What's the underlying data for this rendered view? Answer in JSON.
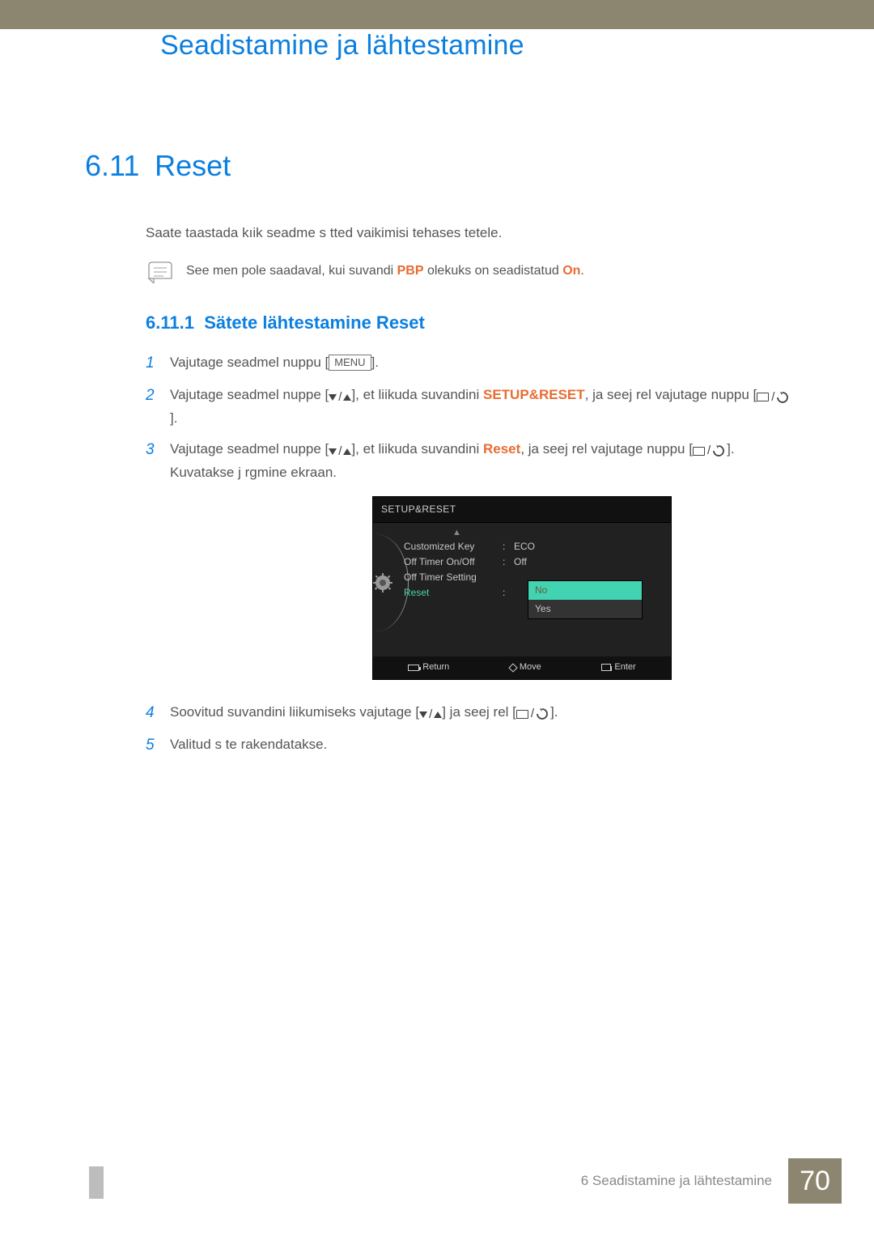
{
  "header": {
    "chapter_title": "Seadistamine ja lähtestamine"
  },
  "section": {
    "number": "6.11",
    "title": "Reset",
    "intro": "Saate taastada kıik seadme s  tted vaikimisi tehases  tetele.",
    "note_prefix": "See men     pole saadaval, kui suvandi ",
    "note_hl1": "PBP",
    "note_mid": " olekuks on seadistatud ",
    "note_hl2": "On",
    "note_suffix": "."
  },
  "subsection": {
    "number": "6.11.1",
    "title": "Sätete lähtestamine Reset"
  },
  "steps": {
    "s1_a": "Vajutage seadmel nuppu [",
    "s1_menu": "MENU",
    "s1_b": "].",
    "s2_a": "Vajutage seadmel nuppe [",
    "s2_b": "], et liikuda suvandini ",
    "s2_hl": "SETUP&RESET",
    "s2_c": ", ja seej  rel vajutage nuppu [",
    "s2_d": "].",
    "s3_a": "Vajutage seadmel nuppe [",
    "s3_b": "], et liikuda suvandini ",
    "s3_hl": "Reset",
    "s3_c": ", ja seej  rel vajutage nuppu [",
    "s3_d": "]. Kuvatakse j  rgmine ekraan.",
    "s4_a": "Soovitud suvandini liikumiseks vajutage [",
    "s4_b": "] ja seej  rel [",
    "s4_c": "].",
    "s5": "Valitud s  te rakendatakse."
  },
  "osd": {
    "title": "SETUP&RESET",
    "rows": [
      {
        "label": "Customized Key",
        "value": "ECO"
      },
      {
        "label": "Off Timer On/Off",
        "value": "Off"
      },
      {
        "label": "Off Timer Setting",
        "value": ""
      },
      {
        "label": "Reset",
        "value": ""
      }
    ],
    "popup": {
      "no": "No",
      "yes": "Yes"
    },
    "footer": {
      "return": "Return",
      "move": "Move",
      "enter": "Enter"
    }
  },
  "footer": {
    "label": "6 Seadistamine ja lähtestamine",
    "page": "70"
  }
}
